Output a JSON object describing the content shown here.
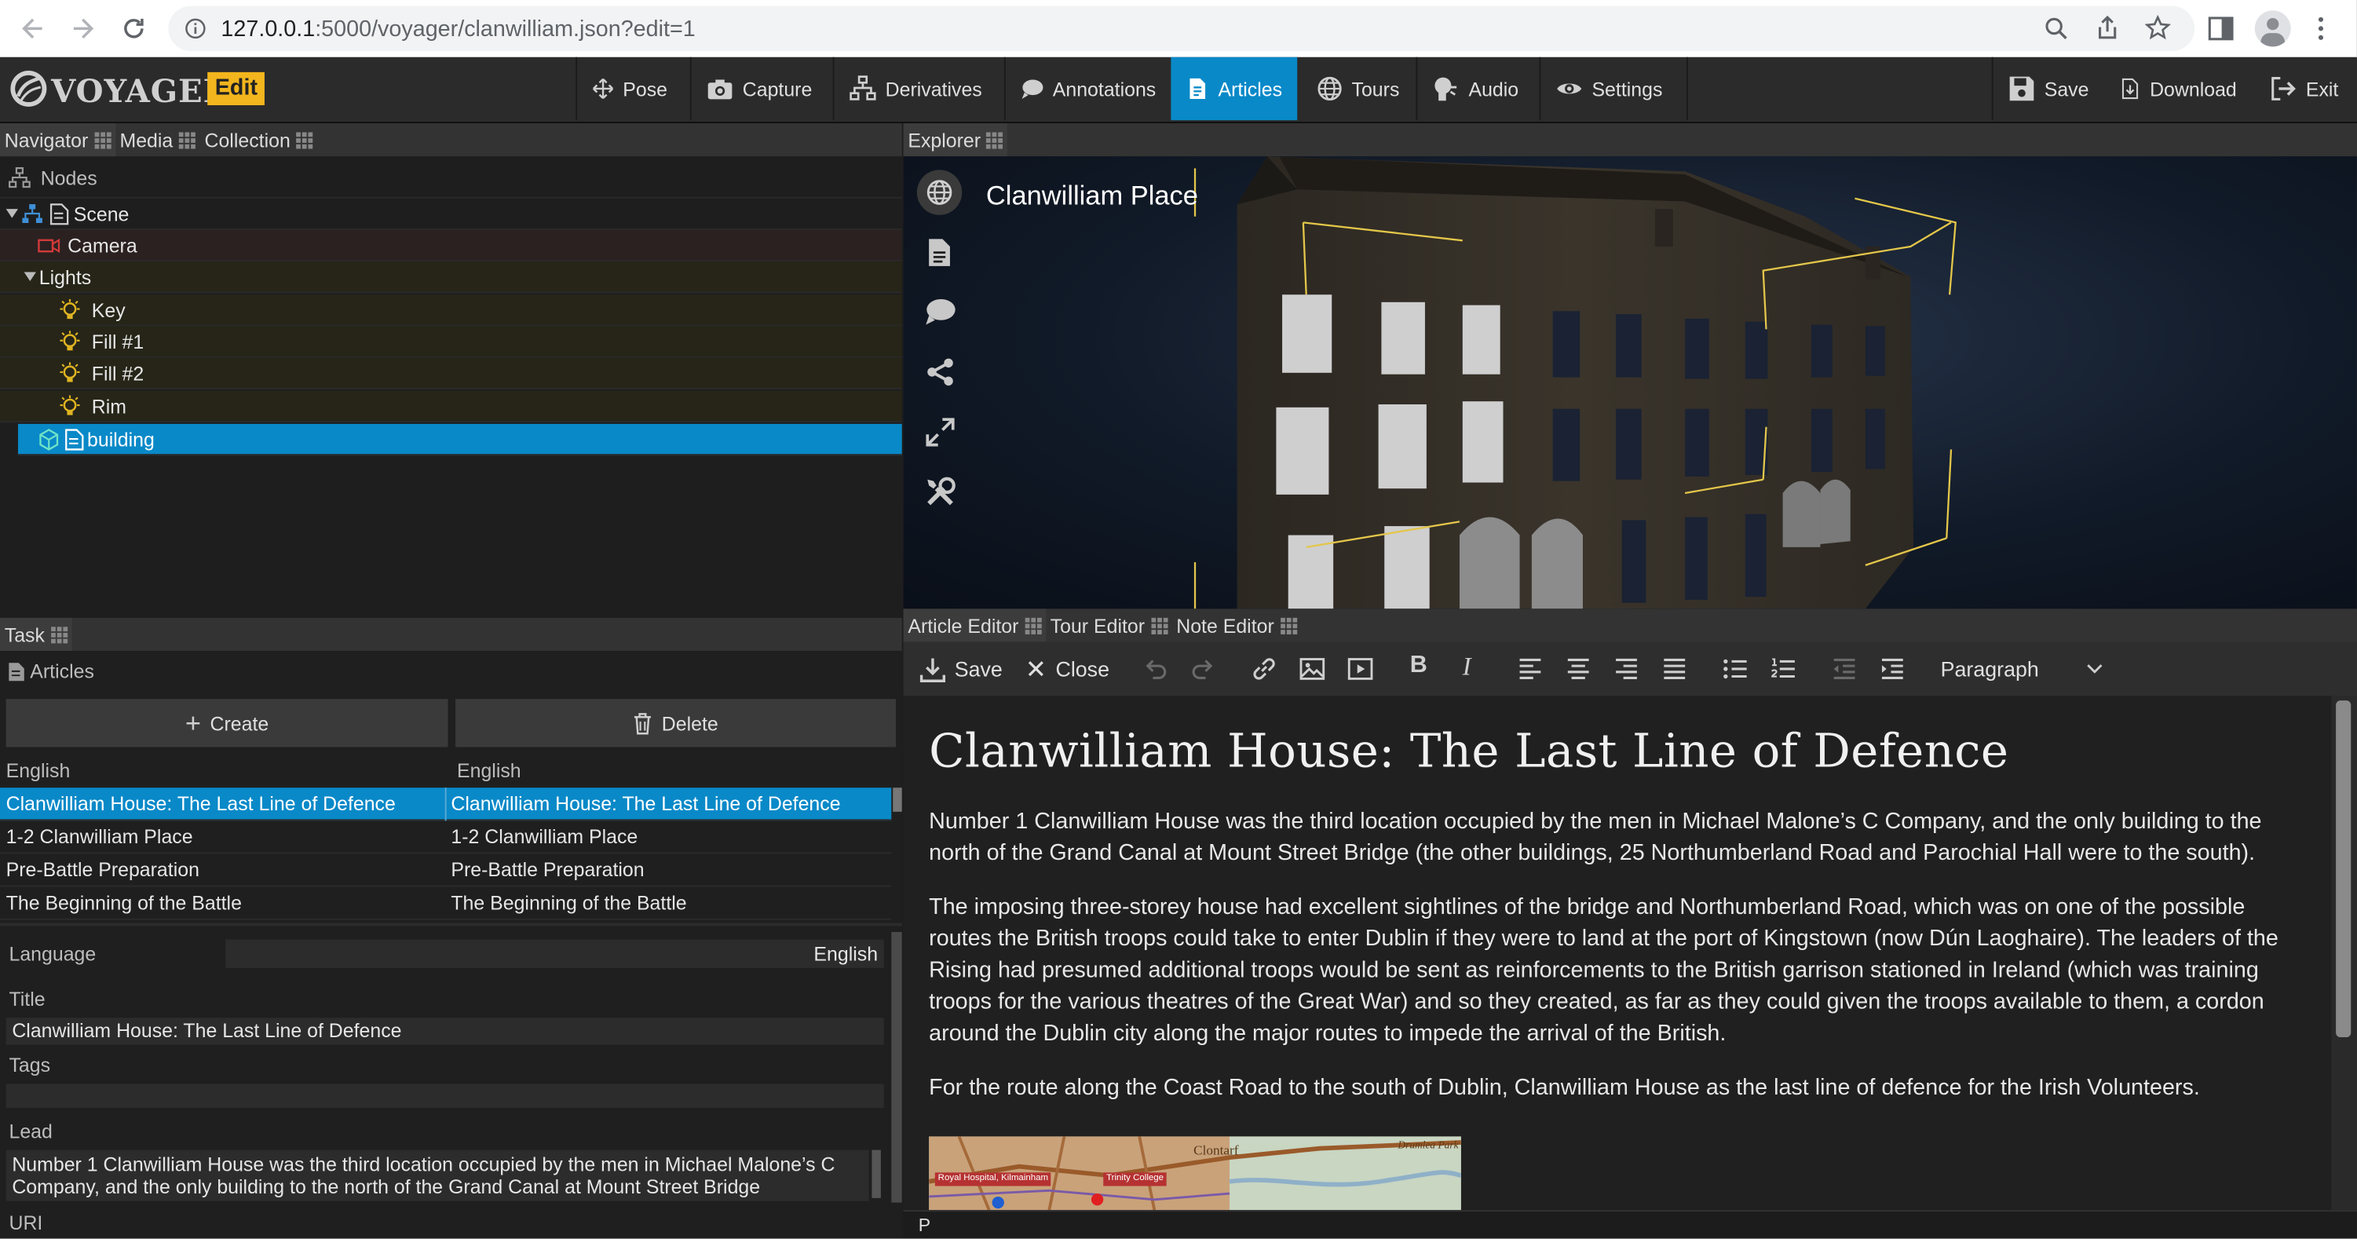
{
  "browser": {
    "url_host": "127.0.0.1",
    "url_rest": ":5000/voyager/clanwilliam.json?edit=1"
  },
  "app": {
    "logo": "VOYAGER",
    "mode_badge": "Edit",
    "toolbar": [
      {
        "label": "Pose",
        "icon": "move-icon"
      },
      {
        "label": "Capture",
        "icon": "camera-icon"
      },
      {
        "label": "Derivatives",
        "icon": "hierarchy-icon"
      },
      {
        "label": "Annotations",
        "icon": "comment-icon"
      },
      {
        "label": "Articles",
        "icon": "document-icon",
        "active": true
      },
      {
        "label": "Tours",
        "icon": "globe-icon"
      },
      {
        "label": "Audio",
        "icon": "audio-icon"
      },
      {
        "label": "Settings",
        "icon": "eye-icon"
      }
    ],
    "actions": {
      "save": "Save",
      "download": "Download",
      "exit": "Exit"
    },
    "accent_color": "#0989c8",
    "badge_color": "#f2b51d"
  },
  "navigator": {
    "tabs": [
      "Navigator",
      "Media",
      "Collection"
    ],
    "section": "Nodes",
    "tree": [
      {
        "label": "Scene",
        "kind": "scene"
      },
      {
        "label": "Camera",
        "kind": "camera"
      },
      {
        "label": "Lights",
        "kind": "group"
      },
      {
        "label": "Key",
        "kind": "light"
      },
      {
        "label": "Fill #1",
        "kind": "light"
      },
      {
        "label": "Fill #2",
        "kind": "light"
      },
      {
        "label": "Rim",
        "kind": "light"
      },
      {
        "label": "building",
        "kind": "model",
        "selected": true
      }
    ]
  },
  "task": {
    "tab": "Task",
    "section": "Articles",
    "create_label": "Create",
    "delete_label": "Delete",
    "columns": [
      "English",
      "English"
    ],
    "articles": [
      {
        "a": "Clanwilliam House: The Last Line of Defence",
        "b": "Clanwilliam House: The Last Line of Defence",
        "selected": true
      },
      {
        "a": "1-2 Clanwilliam Place",
        "b": "1-2 Clanwilliam Place"
      },
      {
        "a": "Pre-Battle Preparation",
        "b": "Pre-Battle Preparation"
      },
      {
        "a": "The Beginning of the Battle",
        "b": "The Beginning of the Battle"
      }
    ],
    "fields": {
      "language_label": "Language",
      "language_value": "English",
      "title_label": "Title",
      "title_value": "Clanwilliam House: The Last Line of Defence",
      "tags_label": "Tags",
      "tags_value": "",
      "lead_label": "Lead",
      "lead_value": "Number 1 Clanwilliam House was the third location occupied by the men in Michael Malone’s C Company, and the only building to the north of the Grand Canal at Mount Street Bridge",
      "uri_label": "URI"
    }
  },
  "explorer": {
    "tab": "Explorer",
    "scene_title": "Clanwilliam Place",
    "side_tools": [
      "globe-icon",
      "document-icon",
      "comment-icon",
      "share-icon",
      "fullscreen-icon",
      "tools-icon"
    ]
  },
  "editor": {
    "tabs": [
      "Article Editor",
      "Tour Editor",
      "Note Editor"
    ],
    "save_label": "Save",
    "close_label": "Close",
    "block_format": "Paragraph",
    "status_path": "P",
    "article": {
      "title": "Clanwilliam House: The Last Line of Defence",
      "paragraphs": [
        "Number 1 Clanwilliam House was the third location occupied by the men in Michael Malone’s C Company, and the only building to the north of the Grand Canal at Mount Street Bridge (the other buildings, 25 Northumberland Road and Parochial Hall were to the south).",
        "The imposing three-storey house had excellent sightlines of the bridge and Northumberland Road, which was on one of the possible routes the British troops could take to enter Dublin if they were to land at the port of Kingstown (now Dún Laoghaire). The leaders of the Rising had presumed additional troops would be sent as reinforcements to the British garrison stationed in Ireland (which was training troops for the various theatres of the Great War) and so they created, as far as they could given the troops available to them, a cordon around the Dublin city along the major routes to impede the arrival of the British.",
        "For the route along the Coast Road to the south of Dublin, Clanwilliam House as the last line of defence for the Irish Volunteers."
      ],
      "map_labels": [
        "Royal Hospital, Kilmainham",
        "Trinity College",
        "Clontarf",
        "Drumlea Park"
      ]
    }
  }
}
